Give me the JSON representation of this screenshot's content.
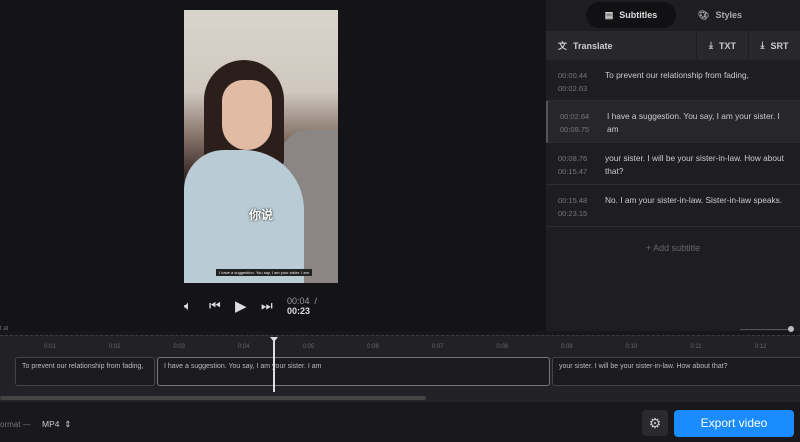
{
  "player": {
    "burned_subtitle_cn": "你说",
    "burned_subtitle_en": "I have a suggestion. You say, I am your sister. I am",
    "current_time": "00:04",
    "separator": "/",
    "duration": "00:23"
  },
  "panel": {
    "tabs": [
      {
        "label": "Subtitles",
        "icon": "subtitles-icon",
        "active": true
      },
      {
        "label": "Styles",
        "icon": "palette-icon",
        "active": false
      }
    ],
    "toolbar": {
      "translate": "Translate",
      "txt": "TXT",
      "srt": "SRT"
    },
    "subtitles": [
      {
        "start": "00:00.44",
        "end": "00:02.63",
        "text": "To prevent our relationship from fading,"
      },
      {
        "start": "00:02.64",
        "end": "00:08.75",
        "text": "I have a suggestion. You say, I am your sister. I am",
        "selected": true
      },
      {
        "start": "00:08.76",
        "end": "00:15.47",
        "text": "your sister. I will be your sister-in-law. How about that?"
      },
      {
        "start": "00:15.48",
        "end": "00:23.15",
        "text": "No. I am your sister-in-law. Sister-in-law speaks."
      }
    ],
    "add_subtitle": "Add subtitle"
  },
  "timeline": {
    "cut_label": "t at",
    "ticks": [
      "0:01",
      "0:02",
      "0:03",
      "0:04",
      "0:05",
      "0:06",
      "0:07",
      "0:08",
      "0:09",
      "0:10",
      "0:11",
      "0:12"
    ],
    "clips": [
      "To prevent our relationship from fading,",
      "I have a suggestion. You say, I am your sister. I am",
      "your sister. I will be your sister-in-law. How about that?"
    ]
  },
  "bottom": {
    "format_label": "ormat —",
    "format_value": "MP4",
    "export": "Export video"
  },
  "colors": {
    "accent": "#1a8cff"
  }
}
